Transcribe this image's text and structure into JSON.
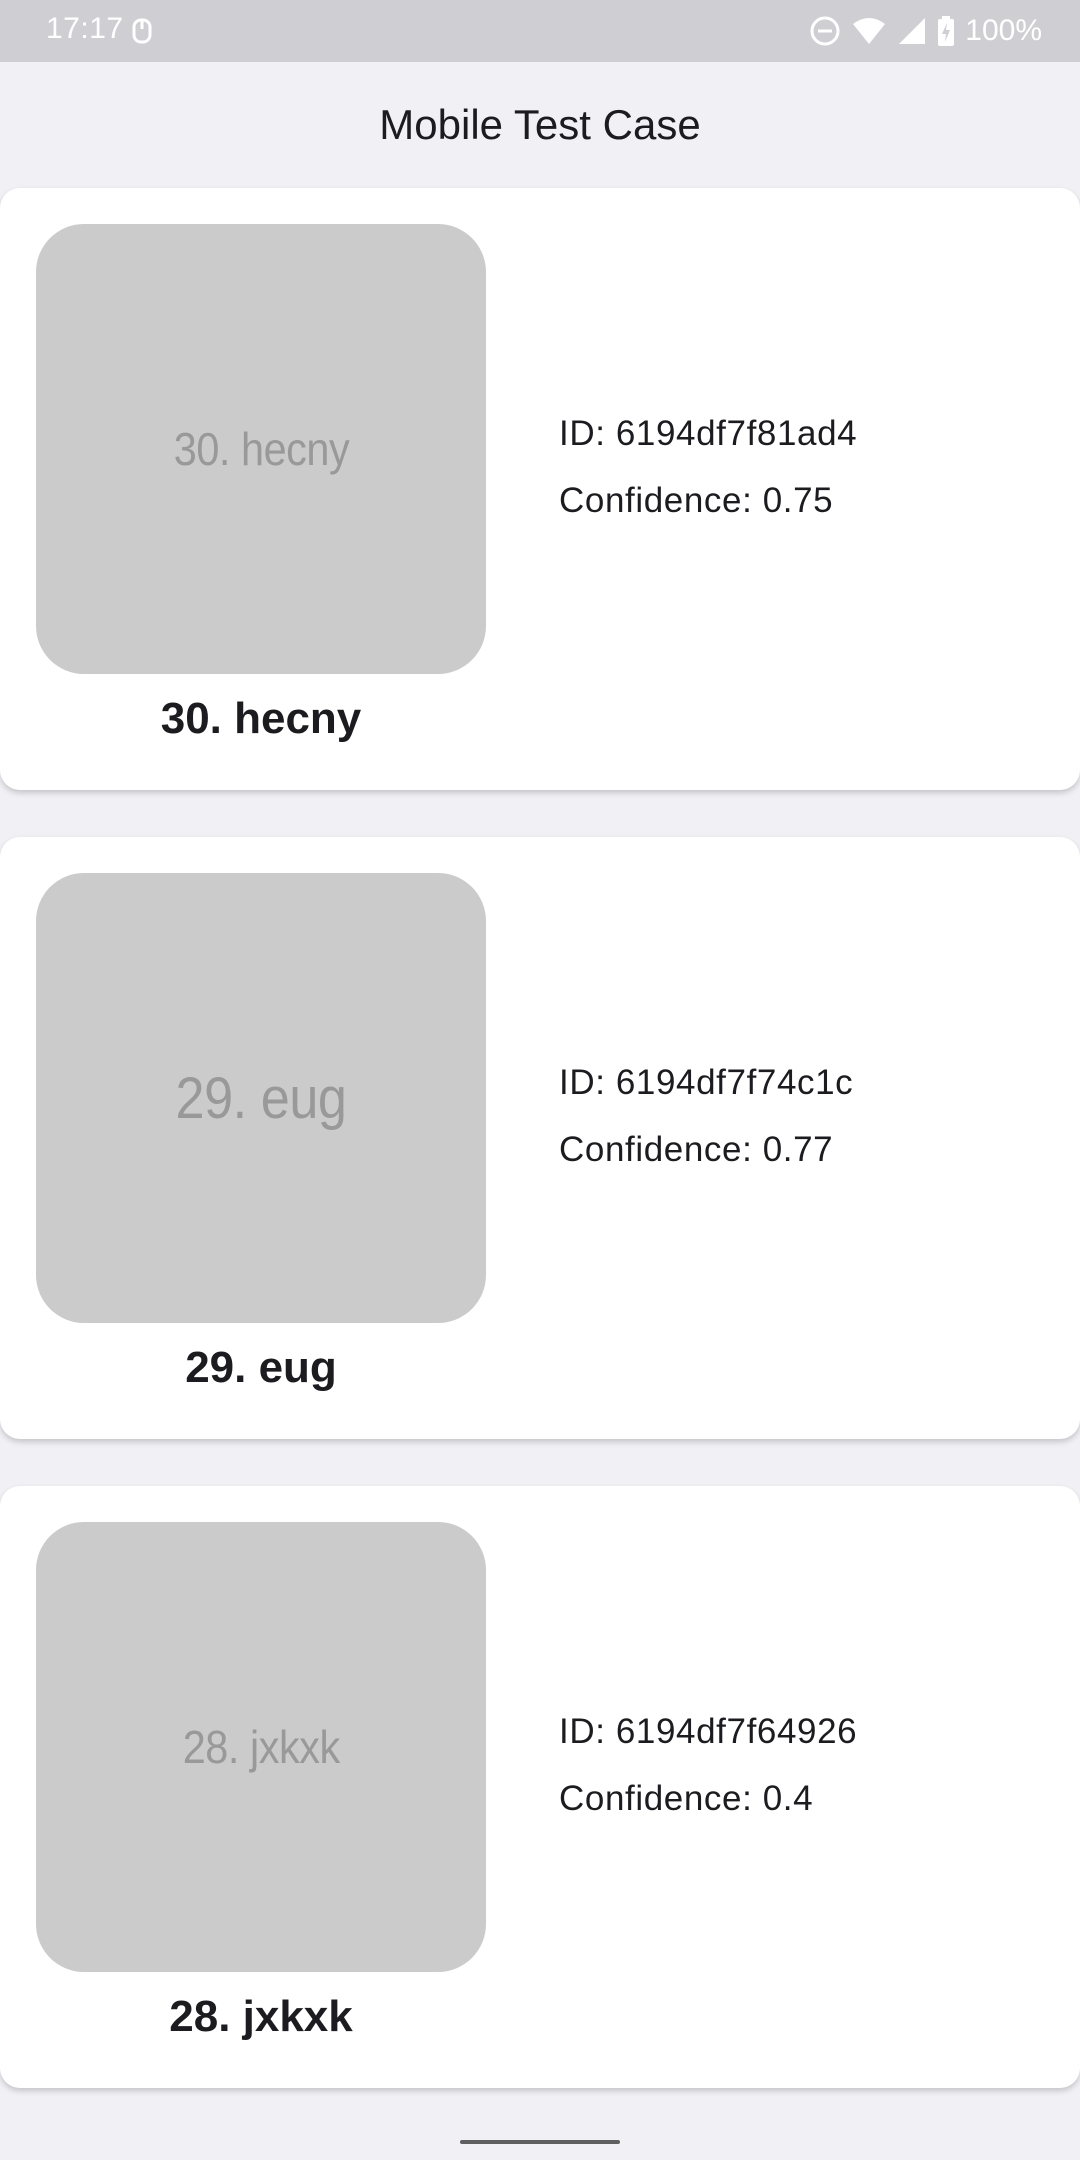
{
  "status_bar": {
    "time": "17:17",
    "battery": "100%",
    "icons": [
      "app-notification-icon",
      "do-not-disturb-icon",
      "wifi-icon",
      "cell-signal-icon",
      "battery-charging-icon"
    ]
  },
  "app_bar": {
    "title": "Mobile Test Case"
  },
  "items": [
    {
      "thumb_text": "30. hecny",
      "name": "30. hecny",
      "id": "ID: 6194df7f81ad4",
      "confidence": "Confidence: 0.75"
    },
    {
      "thumb_text": "29. eug",
      "name": "29. eug",
      "id": "ID: 6194df7f74c1c",
      "confidence": "Confidence: 0.77"
    },
    {
      "thumb_text": "28. jxkxk",
      "name": "28. jxkxk",
      "id": "ID: 6194df7f64926",
      "confidence": "Confidence: 0.4"
    }
  ],
  "colors": {
    "background": "#f1f0f5",
    "card": "#ffffff",
    "thumbnail": "#cbcbcb",
    "status_bar": "#cfced3"
  }
}
